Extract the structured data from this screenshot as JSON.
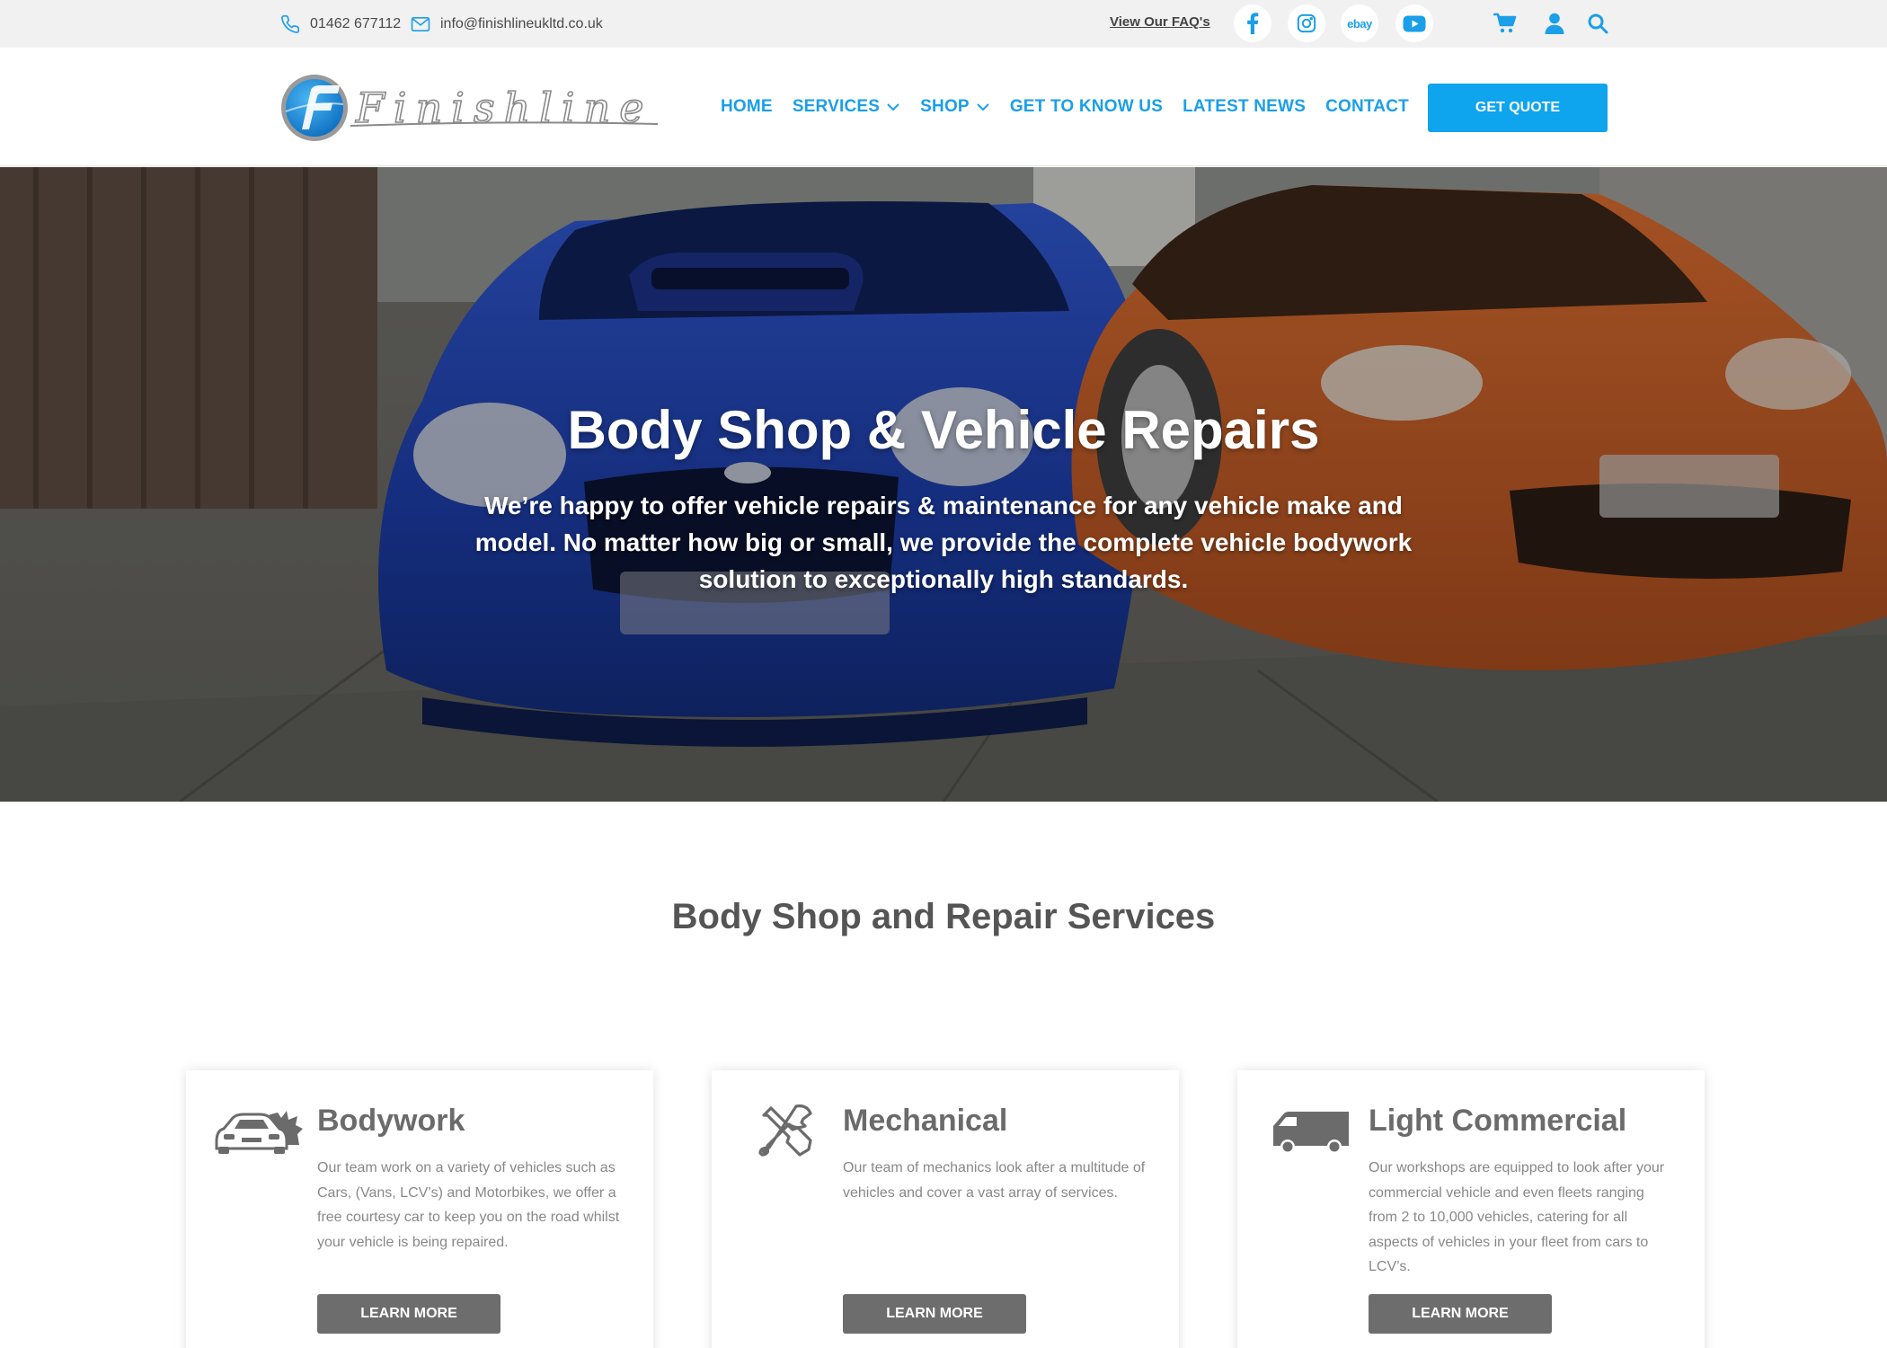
{
  "topbar": {
    "phone": "01462 677112",
    "email": "info@finishlineukltd.co.uk",
    "faq_link": "View Our FAQ's",
    "socials": [
      "facebook-icon",
      "instagram-icon",
      "ebay-icon",
      "youtube-icon"
    ],
    "ebay_label": "ebay",
    "tools": [
      "cart-icon",
      "user-icon",
      "search-icon"
    ]
  },
  "header": {
    "logo_text": "Finishline",
    "nav": [
      {
        "label": "HOME",
        "dropdown": false
      },
      {
        "label": "SERVICES",
        "dropdown": true
      },
      {
        "label": "SHOP",
        "dropdown": true
      },
      {
        "label": "GET TO KNOW US",
        "dropdown": false
      },
      {
        "label": "LATEST NEWS",
        "dropdown": false
      },
      {
        "label": "CONTACT",
        "dropdown": false
      }
    ],
    "quote_button": "GET QUOTE"
  },
  "hero": {
    "title": "Body Shop & Vehicle Repairs",
    "subtitle": "We’re happy to offer vehicle repairs & maintenance for any vehicle make and model. No matter how big or small, we provide the complete vehicle bodywork solution to exceptionally high standards."
  },
  "services": {
    "title": "Body Shop and Repair Services",
    "cards": [
      {
        "icon": "cars-icon",
        "title": "Bodywork",
        "text": "Our team work on a variety of vehicles such as Cars, (Vans, LCV’s) and Motorbikes, we offer a free courtesy car to keep you on the road whilst your vehicle is being repaired.",
        "button": "LEARN MORE"
      },
      {
        "icon": "tools-icon",
        "title": "Mechanical",
        "text": "Our team of mechanics look after a multitude of vehicles and cover a vast array of services.",
        "button": "LEARN MORE"
      },
      {
        "icon": "van-icon",
        "title": "Light Commercial",
        "text": "Our workshops are equipped to look after your commercial vehicle and even fleets ranging from 2 to 10,000 vehicles, catering for all aspects of vehicles in your fleet from cars to LCV’s.",
        "button": "LEARN MORE"
      }
    ]
  },
  "colors": {
    "brand_blue": "#1a9fe8",
    "button_blue": "#0ea4ee",
    "button_grey": "#6d6d6d",
    "topbar_bg": "#f1f1f1"
  }
}
